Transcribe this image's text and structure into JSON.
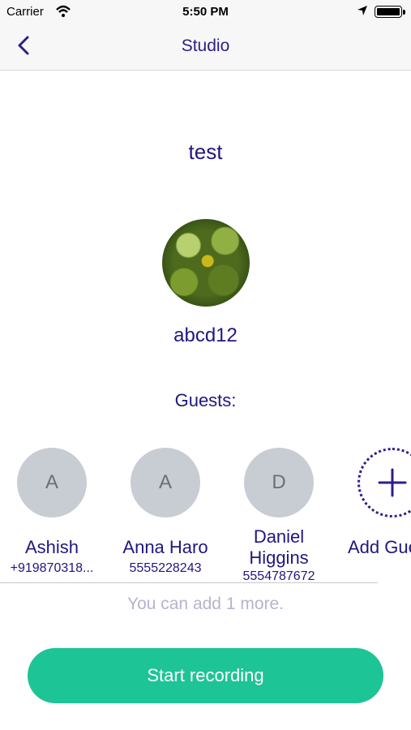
{
  "status_bar": {
    "carrier": "Carrier",
    "time": "5:50 PM"
  },
  "nav": {
    "title": "Studio"
  },
  "studio": {
    "name": "test",
    "host": "abcd12",
    "guests_label": "Guests:"
  },
  "guests": [
    {
      "initial": "A",
      "name": "Ashish",
      "phone": "+919870318..."
    },
    {
      "initial": "A",
      "name": "Anna Haro",
      "phone": "5555228243"
    },
    {
      "initial": "D",
      "name": "Daniel Higgins",
      "phone": "5554787672"
    }
  ],
  "add_guest": {
    "label": "Add Guest"
  },
  "remaining_text": "You can add 1 more.",
  "start_button": {
    "label": "Start recording"
  },
  "colors": {
    "accent": "#1dc496",
    "text": "#1f1780",
    "avatar_bg": "#c8ccd3"
  }
}
